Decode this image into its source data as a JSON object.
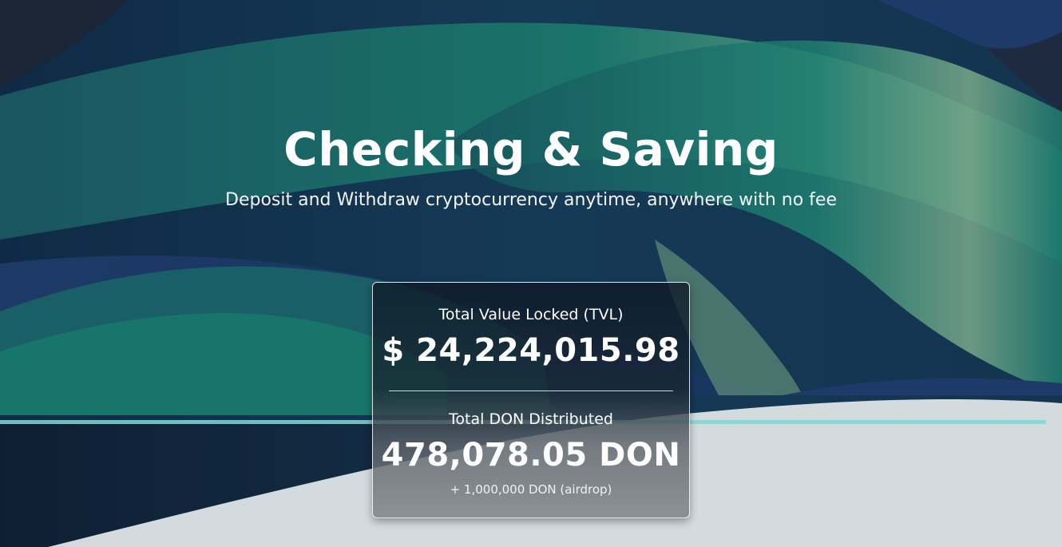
{
  "hero": {
    "title": "Checking & Saving",
    "subtitle": "Deposit and Withdraw cryptocurrency anytime, anywhere with no fee"
  },
  "stats": {
    "tvl_label": "Total Value Locked (TVL)",
    "tvl_value": "$ 24,224,015.98",
    "don_label": "Total DON Distributed",
    "don_value": "478,078.05 DON",
    "airdrop_note": "+ 1,000,000 DON (airdrop)"
  },
  "colors": {
    "background_dark": "#14304d",
    "wave_teal": "#187a6b",
    "wave_navy": "#1e3a66",
    "accent_line": "#84d6d2",
    "bottom_light": "#d3dbdf",
    "text": "#ffffff"
  }
}
